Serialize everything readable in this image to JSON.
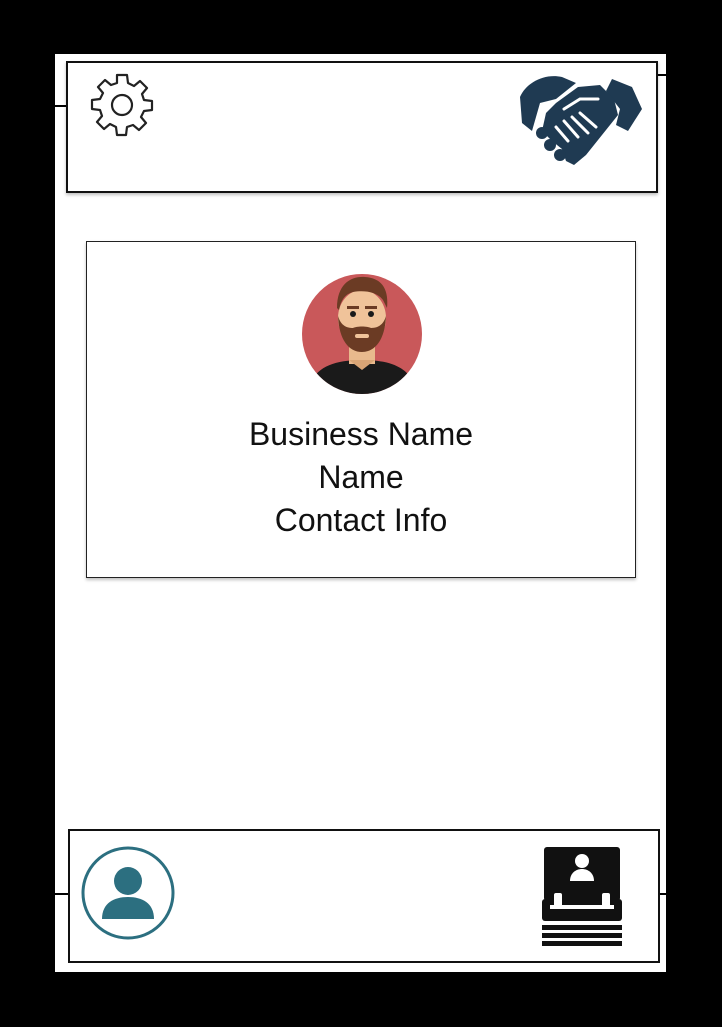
{
  "header": {
    "settings_icon": "gear-icon",
    "partner_icon": "handshake-icon"
  },
  "profile_card": {
    "business_name": "Business Name",
    "name": "Name",
    "contact_info": "Contact Info",
    "avatar_icon": "bearded-man-avatar"
  },
  "footer": {
    "profile_icon": "person-icon",
    "contacts_icon": "contact-book-icon"
  },
  "colors": {
    "frame": "#000000",
    "handshake": "#1f3a52",
    "person_accent": "#2c6f80",
    "avatar_bg": "#c9585a"
  }
}
